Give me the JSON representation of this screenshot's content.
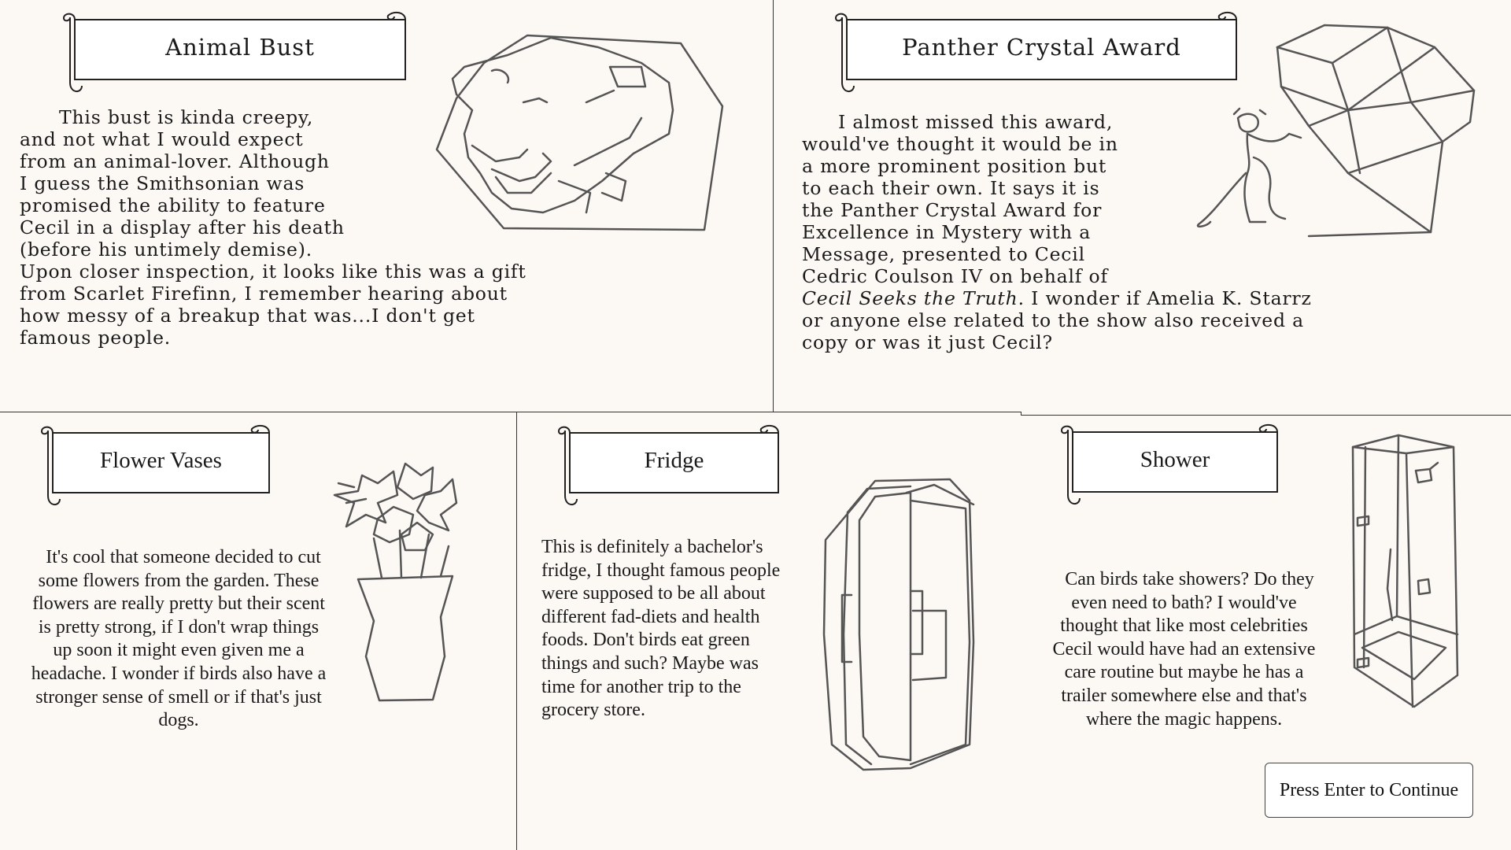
{
  "panels": {
    "bust": {
      "title": "Animal Bust",
      "lines": [
        "This bust is kinda creepy,",
        "and not what I would expect",
        "from an animal-lover. Although",
        "I guess the Smithsonian was",
        "promised the ability to feature",
        "Cecil in a display after his death",
        "(before his untimely demise).",
        "Upon closer inspection, it looks like this was a gift",
        "from Scarlet Firefinn, I remember hearing about",
        "how messy of a breakup that was...I don't get",
        "famous people."
      ],
      "illustration": "lion-head-bust-icon"
    },
    "award": {
      "title": "Panther Crystal Award",
      "lines": [
        "I almost missed this award,",
        "would've thought it would be in",
        "a more prominent position but",
        "to each their own. It says it is",
        "the Panther Crystal Award for",
        "Excellence in Mystery with a",
        "Message, presented to Cecil",
        "Cedric Coulson IV on behalf of"
      ],
      "italic_title": "Cecil Seeks the Truth",
      "line9_rest": ". I wonder if Amelia K. Starrz",
      "lines_end": [
        "or anyone else related to the show also received a",
        "copy or was it just Cecil?"
      ],
      "illustration": "panther-crystal-award-icon"
    },
    "vases": {
      "title": "Flower Vases",
      "lines": [
        "It's cool that someone decided to cut",
        "some flowers from the garden. These",
        "flowers are really pretty but their scent",
        "is pretty strong, if I don't wrap things",
        "up soon it might even given me a",
        "headache. I wonder if birds also have a",
        "stronger sense of smell or if that's just",
        "dogs."
      ],
      "illustration": "flower-vase-icon"
    },
    "fridge": {
      "title": "Fridge",
      "lines": [
        "This is definitely  a bachelor's",
        "fridge, I thought famous people",
        "were supposed to be all about",
        "different fad-diets and health",
        "foods. Don't birds eat green",
        "things and such? Maybe was",
        "time for another trip to the",
        "grocery store."
      ],
      "illustration": "fridge-icon"
    },
    "shower": {
      "title": "Shower",
      "lines": [
        "Can birds take showers? Do they",
        "even need to bath? I would've",
        "thought that like most celebrities",
        "Cecil would have had an extensive",
        "care routine but maybe he has a",
        "trailer somewhere else and that's",
        "where the magic happens."
      ],
      "illustration": "shower-stall-icon"
    }
  },
  "continue_button": {
    "label": "Press Enter to Continue"
  }
}
